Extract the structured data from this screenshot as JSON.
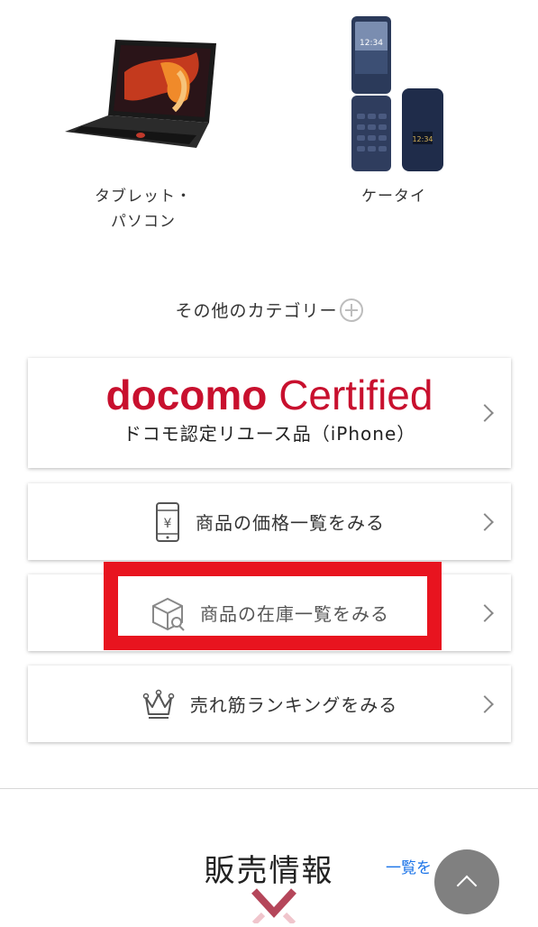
{
  "categories": [
    {
      "label_line1": "タブレット・",
      "label_line2": "パソコン"
    },
    {
      "label_line1": "ケータイ"
    }
  ],
  "more_categories": {
    "label": "その他のカテゴリー"
  },
  "docomo_card": {
    "logo_text_1": "docomo",
    "logo_text_2": "Certified",
    "subtitle": "ドコモ認定リユース品（iPhone）"
  },
  "links": {
    "price_list": "商品の価格一覧をみる",
    "stock_list": "商品の在庫一覧をみる",
    "ranking": "売れ筋ランキングをみる"
  },
  "icons": {
    "price": "price-tag-phone-icon",
    "stock": "package-search-icon",
    "ranking": "crown-icon",
    "expand": "plus-circle-icon",
    "chevron": "chevron-right-icon",
    "scroll_top": "chevron-up-icon"
  },
  "sales_section": {
    "title": "販売情報",
    "see_all": "一覧を"
  },
  "colors": {
    "docomo_red": "#c8102e",
    "highlight": "#e8141f",
    "link": "#1a73e8"
  }
}
